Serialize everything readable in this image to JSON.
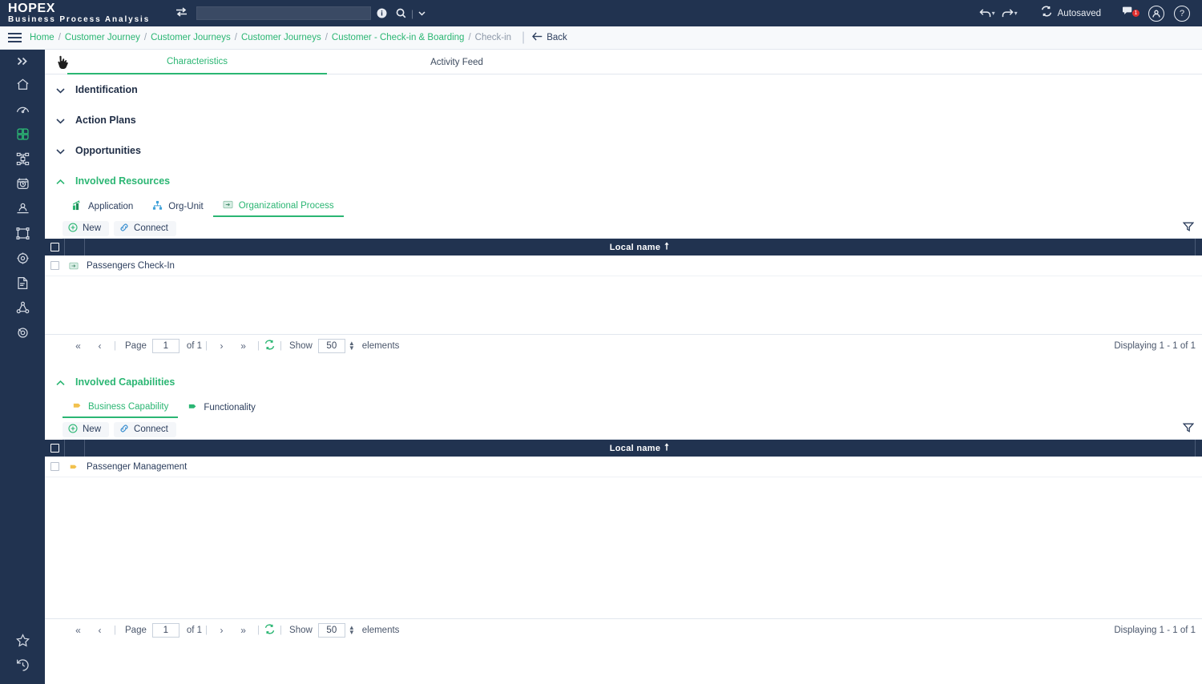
{
  "app": {
    "brand_main": "HOPEX",
    "brand_sub": "Business Process Analysis",
    "search_value": "",
    "search_placeholder": ""
  },
  "topbar": {
    "swap_icon": "swap-icon",
    "info_icon": "info-icon",
    "search_icon": "search-icon",
    "dropdown_caret_icon": "chevron-down-icon",
    "undo_icon": "undo-icon",
    "redo_icon": "redo-icon",
    "sync_icon": "sync-icon",
    "autosaved_label": "Autosaved",
    "notifications_icon": "notification-icon",
    "notifications_count": "1",
    "account_icon": "user-account-icon",
    "help_icon": "help-icon"
  },
  "breadcrumb": {
    "menu_icon": "hamburger-menu-icon",
    "items": [
      {
        "label": "Home",
        "current": false
      },
      {
        "label": "Customer Journey",
        "current": false
      },
      {
        "label": "Customer Journeys",
        "current": false
      },
      {
        "label": "Customer Journeys",
        "current": false
      },
      {
        "label": "Customer - Check-in & Boarding",
        "current": false
      },
      {
        "label": "Check-in",
        "current": true
      }
    ],
    "separator": "/",
    "back_label": "Back",
    "back_icon": "arrow-left-icon"
  },
  "sidebar": {
    "expand_icon": "chevron-double-right-icon",
    "items": [
      {
        "icon": "home-icon",
        "name": "home"
      },
      {
        "icon": "dashboard-gauge-icon",
        "name": "dashboard"
      },
      {
        "icon": "puzzle-grid-icon",
        "name": "capabilities",
        "active": true
      },
      {
        "icon": "process-flow-icon",
        "name": "processes"
      },
      {
        "icon": "target-clock-icon",
        "name": "objectives"
      },
      {
        "icon": "person-desk-icon",
        "name": "organization"
      },
      {
        "icon": "frame-icon",
        "name": "diagrams"
      },
      {
        "icon": "gear-eye-icon",
        "name": "settings"
      },
      {
        "icon": "document-edit-icon",
        "name": "documents"
      },
      {
        "icon": "network-nodes-icon",
        "name": "network"
      },
      {
        "icon": "eye-scan-icon",
        "name": "analysis"
      }
    ],
    "bottom_items": [
      {
        "icon": "star-icon",
        "name": "favorites"
      },
      {
        "icon": "history-icon",
        "name": "history"
      }
    ]
  },
  "main": {
    "tabs": [
      {
        "label": "Characteristics",
        "active": true
      },
      {
        "label": "Activity Feed",
        "active": false
      }
    ],
    "sections": [
      {
        "title": "Identification",
        "expanded": false,
        "chevron": "chevron-down-icon"
      },
      {
        "title": "Action Plans",
        "expanded": false,
        "chevron": "chevron-down-icon"
      },
      {
        "title": "Opportunities",
        "expanded": false,
        "chevron": "chevron-down-icon"
      }
    ]
  },
  "involved_resources": {
    "title": "Involved Resources",
    "chevron": "chevron-up-icon",
    "entity_tabs": [
      {
        "label": "Application",
        "icon": "application-icon",
        "active": false
      },
      {
        "label": "Org-Unit",
        "icon": "org-unit-icon",
        "active": false
      },
      {
        "label": "Organizational Process",
        "icon": "org-process-icon",
        "active": true
      }
    ],
    "toolbar": {
      "new_label": "New",
      "new_icon": "plus-circle-icon",
      "connect_label": "Connect",
      "connect_icon": "link-icon",
      "filter_icon": "filter-icon"
    },
    "grid": {
      "column_header": "Local name",
      "sort_icon": "sort-ascending-icon",
      "select_all_icon": "select-all-checkbox",
      "rows": [
        {
          "name": "Passengers Check-In",
          "icon": "org-process-icon",
          "checked": false
        }
      ]
    },
    "pager": {
      "first_icon": "double-chevron-left-icon",
      "prev_icon": "chevron-left-icon",
      "next_icon": "chevron-right-icon",
      "last_icon": "double-chevron-right-icon",
      "refresh_icon": "refresh-icon",
      "page_label": "Page",
      "page_value": "1",
      "of_label": "of 1",
      "show_label": "Show",
      "show_value": "50",
      "elements_label": "elements",
      "displaying_label": "Displaying 1 - 1 of 1"
    }
  },
  "involved_capabilities": {
    "title": "Involved Capabilities",
    "chevron": "chevron-up-icon",
    "entity_tabs": [
      {
        "label": "Business Capability",
        "icon": "business-capability-icon",
        "active": true
      },
      {
        "label": "Functionality",
        "icon": "functionality-icon",
        "active": false
      }
    ],
    "toolbar": {
      "new_label": "New",
      "new_icon": "plus-circle-icon",
      "connect_label": "Connect",
      "connect_icon": "link-icon",
      "filter_icon": "filter-icon"
    },
    "grid": {
      "column_header": "Local name",
      "sort_icon": "sort-ascending-icon",
      "select_all_icon": "select-all-checkbox",
      "rows": [
        {
          "name": "Passenger Management",
          "icon": "business-capability-icon",
          "checked": false
        }
      ]
    },
    "pager": {
      "first_icon": "double-chevron-left-icon",
      "prev_icon": "chevron-left-icon",
      "next_icon": "chevron-right-icon",
      "last_icon": "double-chevron-right-icon",
      "refresh_icon": "refresh-icon",
      "page_label": "Page",
      "page_value": "1",
      "of_label": "of 1",
      "show_label": "Show",
      "show_value": "50",
      "elements_label": "elements",
      "displaying_label": "Displaying 1 - 1 of 1"
    }
  },
  "colors": {
    "navy": "#213350",
    "green": "#2bb673",
    "text_dark": "#2c3e5d",
    "badge_red": "#e03030",
    "capability_yellow": "#f2c14e",
    "functionality_green": "#2bb673"
  }
}
